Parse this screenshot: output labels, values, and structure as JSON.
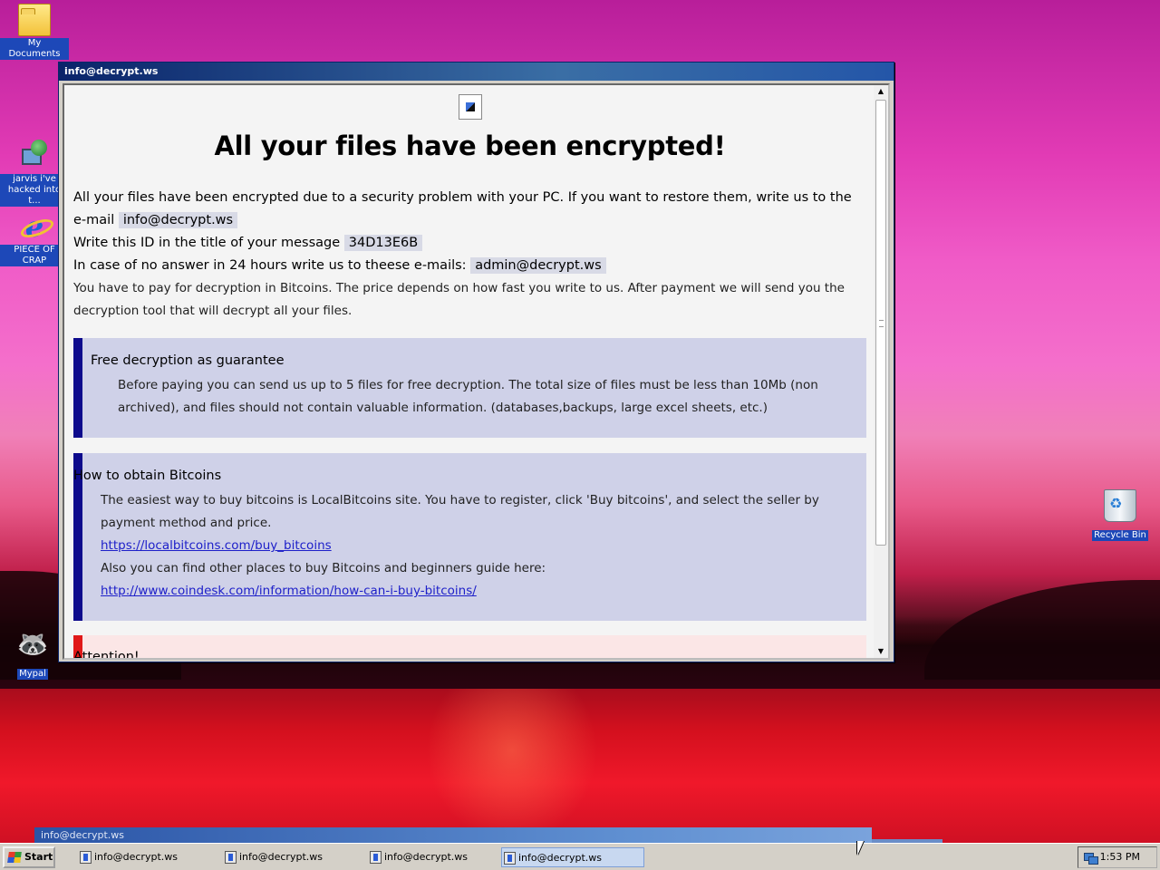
{
  "desktop": {
    "icons": [
      {
        "label": "My Documents",
        "icon": "folder-icon"
      },
      {
        "label": "jarvis i've hacked into t...",
        "icon": "network-computer-icon"
      },
      {
        "label": "PIECE OF CRAP",
        "icon": "internet-explorer-icon"
      },
      {
        "label": "Mypal",
        "icon": "mypal-raccoon-icon"
      },
      {
        "label": "Recycle Bin",
        "icon": "recycle-bin-icon"
      }
    ]
  },
  "window": {
    "title": "info@decrypt.ws",
    "heading": "All your files have been encrypted!",
    "intro": {
      "line1": "All your files have been encrypted due to a security problem with your PC. If you want to restore them, write us to the e-mail",
      "email": "info@decrypt.ws",
      "line2": "Write this ID in the title of your message",
      "id": "34D13E6B",
      "line3": "In case of no answer in 24 hours write us to theese e-mails:",
      "email2": "admin@decrypt.ws",
      "line4": "You have to pay for decryption in Bitcoins. The price depends on how fast you write to us. After payment we will send you the decryption tool that will decrypt all your files."
    },
    "guarantee": {
      "title": "Free decryption as guarantee",
      "body": "Before paying you can send us up to 5 files for free decryption. The total size of files must be less than 10Mb (non archived), and files should not contain valuable information. (databases,backups, large excel sheets, etc.)"
    },
    "bitcoins": {
      "title": "How to obtain Bitcoins",
      "body": "The easiest way to buy bitcoins is LocalBitcoins site. You have to register, click 'Buy bitcoins', and select the seller by payment method and price.",
      "link1": "https://localbitcoins.com/buy_bitcoins",
      "body2": "Also you can find other places to buy Bitcoins and beginners guide here:",
      "link2": "http://www.coindesk.com/information/how-can-i-buy-bitcoins/"
    },
    "attention": {
      "title": "Attention!"
    }
  },
  "background_window": {
    "title": "info@decrypt.ws"
  },
  "taskbar": {
    "start_label": "Start",
    "tasks": [
      "info@decrypt.ws",
      "info@decrypt.ws",
      "info@decrypt.ws",
      "info@decrypt.ws"
    ],
    "active_task_index": 3,
    "clock": "1:53 PM"
  },
  "colors": {
    "guarantee_bar": "#0d0a8c",
    "box_bg": "#cfd1e8",
    "attention_bar": "#e01818",
    "attention_bg": "#fbe6e6",
    "link": "#1e20c9",
    "titlebar": "#0a246a"
  }
}
